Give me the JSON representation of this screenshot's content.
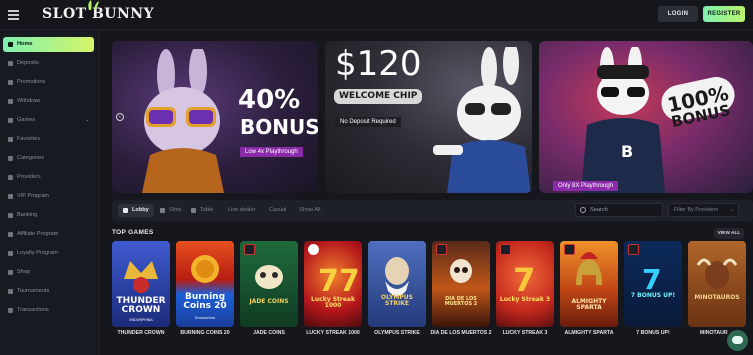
{
  "header": {
    "logo_text": "SLOT BUNNY",
    "login_label": "LOGIN",
    "register_label": "REGISTER"
  },
  "sidebar": {
    "items": [
      {
        "label": "Home",
        "icon": "home-icon",
        "active": true
      },
      {
        "label": "Deposits",
        "icon": "deposit-icon"
      },
      {
        "label": "Promotions",
        "icon": "promotions-icon"
      },
      {
        "label": "Withdraw",
        "icon": "withdraw-icon"
      },
      {
        "label": "Games",
        "icon": "games-icon",
        "expandable": true
      },
      {
        "label": "Favorites",
        "icon": "heart-icon"
      },
      {
        "label": "Categories",
        "icon": "categories-icon"
      },
      {
        "label": "Providers",
        "icon": "providers-icon"
      },
      {
        "label": "VIP Program",
        "icon": "vip-icon"
      },
      {
        "label": "Banking",
        "icon": "banking-icon"
      },
      {
        "label": "Affiliate Program",
        "icon": "affiliate-icon"
      },
      {
        "label": "Loyalty Program",
        "icon": "loyalty-icon"
      },
      {
        "label": "Shop",
        "icon": "shop-icon"
      },
      {
        "label": "Tournaments",
        "icon": "trophy-icon"
      },
      {
        "label": "Transactions",
        "icon": "transactions-icon"
      }
    ]
  },
  "banners": [
    {
      "headline": "40%",
      "sub": "BONUS",
      "tag": "Low 4x Playthrough"
    },
    {
      "headline": "$120",
      "sub": "WELCOME CHIP",
      "tag": "No Deposit Required"
    },
    {
      "headline": "100%",
      "sub": "BONUS",
      "tag": "Only 8X Playthrough"
    }
  ],
  "filters": {
    "tabs": [
      "Lobby",
      "Slots",
      "Table",
      "Live dealer",
      "Casual",
      "Show All"
    ],
    "search_placeholder": "Search",
    "providers_placeholder": "Filter By Providers"
  },
  "top_games": {
    "title": "TOP GAMES",
    "view_all": "VIEW ALL",
    "games": [
      {
        "name": "THUNDER CROWN",
        "art_text": "THUNDER CROWN",
        "art_sub": "ENDORPHINA"
      },
      {
        "name": "BURNING COINS 20",
        "art_text": "Burning Coins 20",
        "art_sub": "Endorphina"
      },
      {
        "name": "JADE COINS",
        "art_text": "JADE COINS"
      },
      {
        "name": "LUCKY STREAK 1000",
        "art_text": "Lucky Streak 1000"
      },
      {
        "name": "OLYMPUS STRIKE",
        "art_text": "OLYMPUS STRIKE"
      },
      {
        "name": "DIA DE LOS MUERTOS 2",
        "art_text": "DIA DE LOS MUERTOS 2"
      },
      {
        "name": "LUCKY STREAK 3",
        "art_text": "Lucky Streak 3"
      },
      {
        "name": "ALMIGHTY SPARTA",
        "art_text": "ALMIGHTY SPARTA"
      },
      {
        "name": "7 BONUS UP!",
        "art_text": "7 BONUS UP!"
      },
      {
        "name": "MINOTAUR",
        "art_text": "MINOTAUROS"
      }
    ]
  },
  "colors": {
    "accent_start": "#7ff0b0",
    "accent_end": "#d6f56a",
    "background": "#15171d"
  }
}
